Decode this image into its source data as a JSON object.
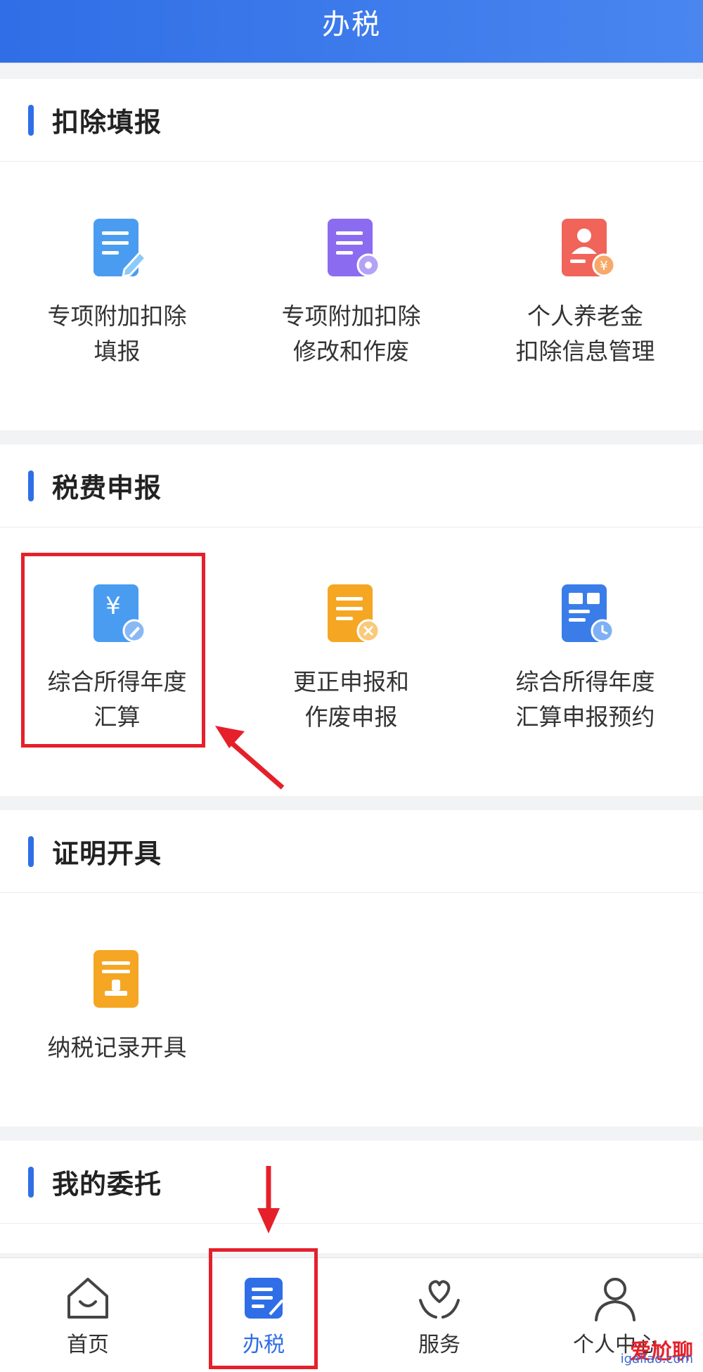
{
  "header": {
    "title": "办税"
  },
  "sections": [
    {
      "title": "扣除填报",
      "items": [
        {
          "label": "专项附加扣除\n填报",
          "icon": "form-edit-icon",
          "color": "#4a9cf0"
        },
        {
          "label": "专项附加扣除\n修改和作废",
          "icon": "form-settings-icon",
          "color": "#8b6cf0"
        },
        {
          "label": "个人养老金\n扣除信息管理",
          "icon": "pension-icon",
          "color": "#f0645a"
        }
      ]
    },
    {
      "title": "税费申报",
      "items": [
        {
          "label": "综合所得年度\n汇算",
          "icon": "annual-settlement-icon",
          "color": "#4a9cf0"
        },
        {
          "label": "更正申报和\n作废申报",
          "icon": "correction-icon",
          "color": "#f5a623"
        },
        {
          "label": "综合所得年度\n汇算申报预约",
          "icon": "appointment-icon",
          "color": "#3a7de8"
        }
      ]
    },
    {
      "title": "证明开具",
      "items": [
        {
          "label": "纳税记录开具",
          "icon": "tax-record-icon",
          "color": "#f5a623"
        }
      ]
    },
    {
      "title": "我的委托",
      "items": []
    }
  ],
  "tabbar": {
    "tabs": [
      {
        "label": "首页",
        "icon": "home-icon",
        "active": false
      },
      {
        "label": "办税",
        "icon": "tax-doc-icon",
        "active": true
      },
      {
        "label": "服务",
        "icon": "heart-hands-icon",
        "active": false
      },
      {
        "label": "个人中心",
        "icon": "user-icon",
        "active": false
      }
    ]
  },
  "watermark": {
    "text": "爱尬聊",
    "url": "igaliao.com"
  },
  "colors": {
    "accent": "#2f6ee6",
    "highlight": "#e5202b"
  }
}
